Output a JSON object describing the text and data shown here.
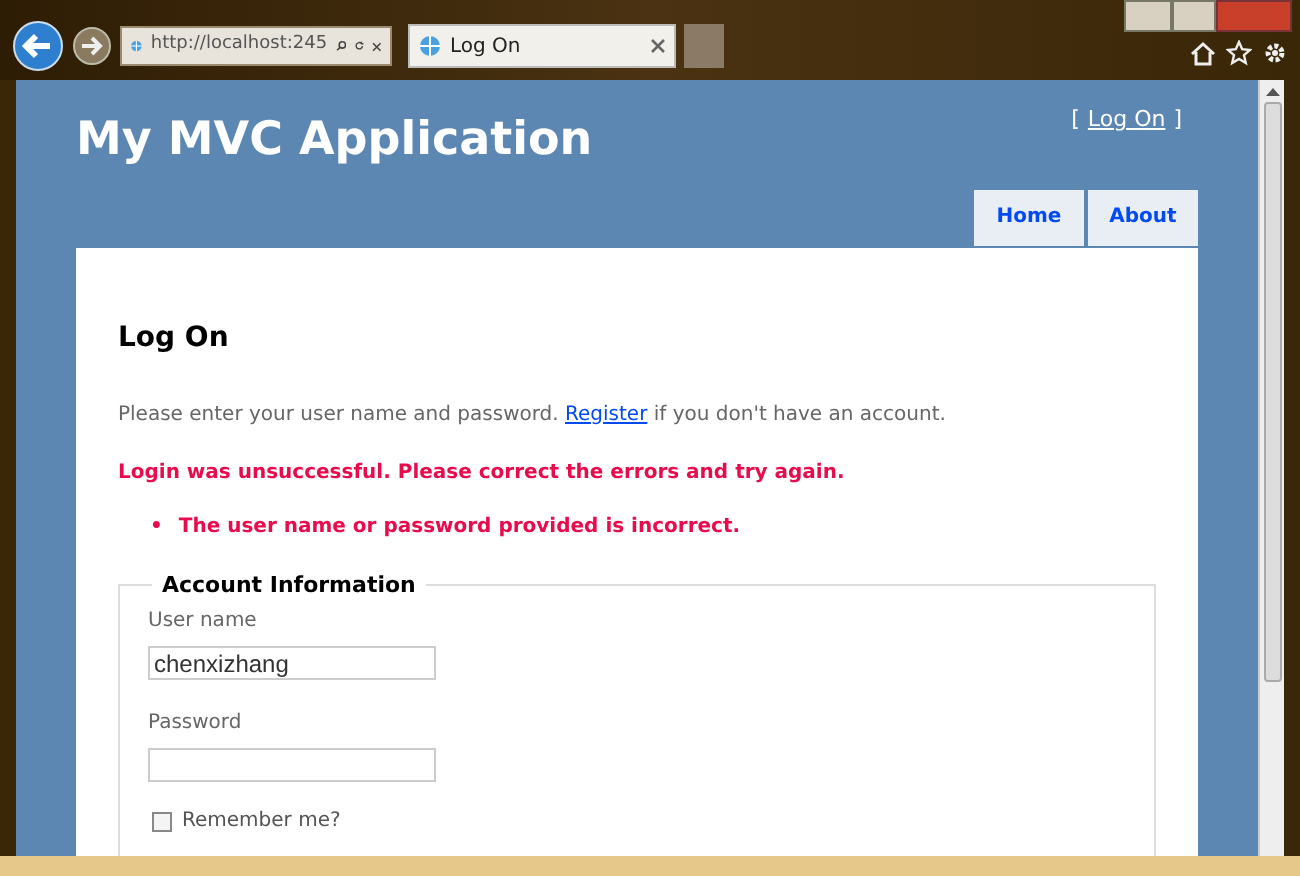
{
  "browser": {
    "address": "http://localhost:245",
    "tab_title": "Log On"
  },
  "site": {
    "title": "My MVC Application",
    "login": {
      "open": "[",
      "link": "Log On",
      "close": "]"
    },
    "menu": [
      {
        "label": "Home"
      },
      {
        "label": "About"
      }
    ]
  },
  "form": {
    "heading": "Log On",
    "intro": {
      "before": "Please enter your user name and password.",
      "link": "Register",
      "after": "if you don't have an account."
    },
    "error_summary": "Login was unsuccessful. Please correct the errors and try again.",
    "errors": [
      {
        "bullet": "•",
        "text": "The user name or password provided is incorrect."
      }
    ],
    "legend": "Account Information",
    "fields": [
      {
        "label": "User name",
        "value": "chenxizhang"
      },
      {
        "label": "Password"
      }
    ],
    "remember": {
      "label": "Remember me?",
      "checked": false
    }
  }
}
